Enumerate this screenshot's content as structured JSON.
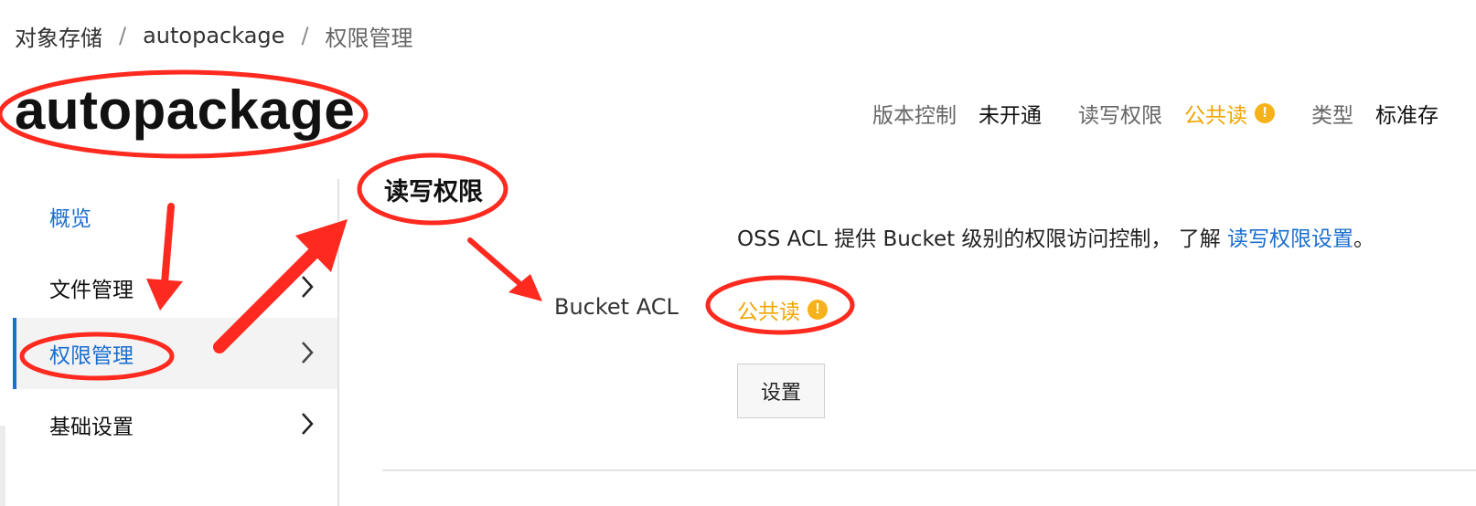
{
  "breadcrumb": {
    "root": "对象存储",
    "separator": "/",
    "bucket": "autopackage",
    "current": "权限管理"
  },
  "bucket_title": "autopackage",
  "meta": {
    "versioning_label": "版本控制",
    "versioning_value": "未开通",
    "acl_label": "读写权限",
    "acl_value": "公共读",
    "type_label": "类型",
    "type_value": "标准存"
  },
  "sidebar": {
    "items": [
      {
        "label": "概览"
      },
      {
        "label": "文件管理"
      },
      {
        "label": "权限管理"
      },
      {
        "label": "基础设置"
      }
    ]
  },
  "section": {
    "title": "读写权限",
    "description": "OSS ACL 提供 Bucket 级别的权限访问控制， 了解 ",
    "description_link": "读写权限设置",
    "description_end": "。",
    "acl_row_label": "Bucket ACL",
    "acl_row_value": "公共读",
    "button_label": "设置"
  },
  "icons": {
    "warning_glyph": "!",
    "chevron": "chevron-right-icon"
  },
  "colors": {
    "link": "#1a6fd0",
    "warning": "#f0a500",
    "annotation": "#ff2a1f"
  }
}
